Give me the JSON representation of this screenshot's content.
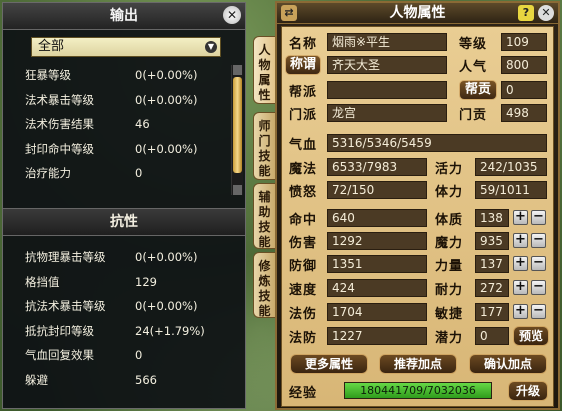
{
  "output_panel": {
    "title": "输出",
    "dropdown_value": "全部",
    "rows": [
      {
        "label": "狂暴等级",
        "value": "0(+0.00%)"
      },
      {
        "label": "法术暴击等级",
        "value": "0(+0.00%)"
      },
      {
        "label": "法术伤害结果",
        "value": "46"
      },
      {
        "label": "封印命中等级",
        "value": "0(+0.00%)"
      },
      {
        "label": "治疗能力",
        "value": "0"
      }
    ]
  },
  "resist_panel": {
    "title": "抗性",
    "rows": [
      {
        "label": "抗物理暴击等级",
        "value": "0(+0.00%)"
      },
      {
        "label": "格挡值",
        "value": "129"
      },
      {
        "label": "抗法术暴击等级",
        "value": "0(+0.00%)"
      },
      {
        "label": "抵抗封印等级",
        "value": "24(+1.79%)"
      },
      {
        "label": "气血回复效果",
        "value": "0"
      },
      {
        "label": "躲避",
        "value": "566"
      }
    ]
  },
  "side_tabs": [
    "人物属性",
    "师门技能",
    "辅助技能",
    "修炼技能"
  ],
  "char_panel": {
    "title": "人物属性",
    "name_label": "名称",
    "name": "烟雨※平生",
    "level_label": "等级",
    "level": "109",
    "title_btn": "称谓",
    "title_value": "齐天大圣",
    "pop_label": "人气",
    "pop": "800",
    "gang_label": "帮派",
    "gang": "",
    "gang_contrib_btn": "帮贡",
    "gang_contrib": "0",
    "sect_label": "门派",
    "sect": "龙宫",
    "sect_contrib_label": "门贡",
    "sect_contrib": "498",
    "hp_label": "气血",
    "hp": "5316/5346/5459",
    "mp_label": "魔法",
    "mp": "6533/7983",
    "vigor_label": "活力",
    "vigor": "242/1035",
    "rage_label": "愤怒",
    "rage": "72/150",
    "stamina_label": "体力",
    "stamina": "59/1011",
    "hit_label": "命中",
    "hit": "640",
    "con_label": "体质",
    "con": "138",
    "dmg_label": "伤害",
    "dmg": "1292",
    "mag_label": "魔力",
    "mag": "935",
    "def_label": "防御",
    "def": "1351",
    "str_label": "力量",
    "str": "137",
    "spd_label": "速度",
    "spd": "424",
    "end_label": "耐力",
    "end": "272",
    "mdmg_label": "法伤",
    "mdmg": "1704",
    "agi_label": "敏捷",
    "agi": "177",
    "mdef_label": "法防",
    "mdef": "1227",
    "pot_label": "潜力",
    "pot": "0",
    "preview_btn": "预览",
    "more_btn": "更多属性",
    "recommend_btn": "推荐加点",
    "confirm_btn": "确认加点",
    "exp_label": "经验",
    "exp": "180441709/7032036",
    "upgrade_btn": "升级",
    "plus": "+",
    "minus": "−",
    "swap_icon": "⇄",
    "help_icon": "?",
    "close_icon": "✕"
  }
}
